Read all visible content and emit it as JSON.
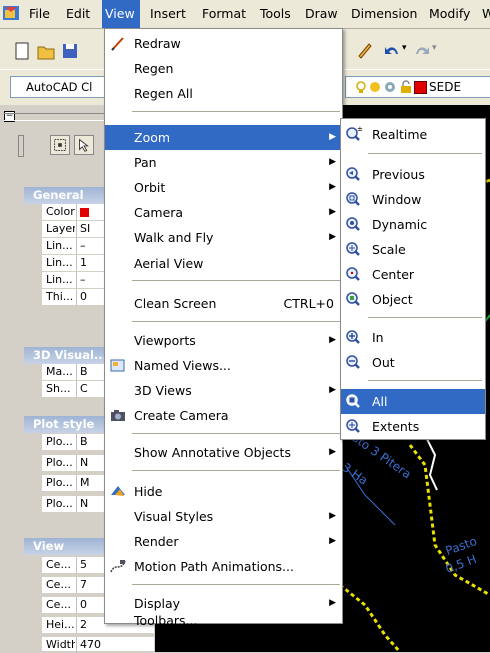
{
  "menubar": {
    "items": [
      "File",
      "Edit",
      "View",
      "Insert",
      "Format",
      "Tools",
      "Draw",
      "Dimension",
      "Modify",
      "W"
    ],
    "active": "View"
  },
  "toolbar": {
    "workspace": "AutoCAD Cl",
    "layer_name": "SEDE"
  },
  "properties": {
    "sections": [
      {
        "title": "General",
        "rows": [
          [
            "Color",
            ""
          ],
          [
            "Layer",
            "SI"
          ],
          [
            "Lin...",
            "–"
          ],
          [
            "Lin...",
            "1"
          ],
          [
            "Lin...",
            "–"
          ],
          [
            "Thi...",
            "0"
          ]
        ]
      },
      {
        "title": "3D Visual...",
        "rows": [
          [
            "Ma...",
            "B"
          ],
          [
            "Sh...",
            "C"
          ]
        ]
      },
      {
        "title": "Plot style",
        "rows": [
          [
            "Plo...",
            "B"
          ],
          [
            "Plo...",
            "N"
          ],
          [
            "Plo...",
            "M"
          ],
          [
            "Plo...",
            "N"
          ]
        ]
      },
      {
        "title": "View",
        "rows": [
          [
            "Ce...",
            "5"
          ],
          [
            "Ce...",
            "7"
          ],
          [
            "Ce...",
            "0"
          ],
          [
            "Hei...",
            "2"
          ],
          [
            "Width",
            "470"
          ]
        ]
      }
    ]
  },
  "view_menu": {
    "items": [
      {
        "label": "Redraw",
        "icon": "redraw-icon"
      },
      {
        "label": "Regen"
      },
      {
        "label": "Regen All"
      },
      {
        "label": "Zoom",
        "submenu": true,
        "highlighted": true
      },
      {
        "label": "Pan",
        "submenu": true
      },
      {
        "label": "Orbit",
        "submenu": true
      },
      {
        "label": "Camera",
        "submenu": true
      },
      {
        "label": "Walk and Fly",
        "submenu": true
      },
      {
        "label": "Aerial View"
      },
      {
        "label": "Clean Screen",
        "shortcut": "CTRL+0"
      },
      {
        "label": "Viewports",
        "submenu": true
      },
      {
        "label": "Named Views...",
        "icon": "named-views-icon"
      },
      {
        "label": "3D Views",
        "submenu": true
      },
      {
        "label": "Create Camera",
        "icon": "camera-icon"
      },
      {
        "label": "Show Annotative Objects",
        "submenu": true
      },
      {
        "label": "Hide",
        "icon": "hide-icon"
      },
      {
        "label": "Visual Styles",
        "submenu": true
      },
      {
        "label": "Render",
        "submenu": true
      },
      {
        "label": "Motion Path Animations...",
        "icon": "motion-path-icon"
      },
      {
        "label": "Display",
        "submenu": true
      },
      {
        "label": "Toolbars..."
      }
    ]
  },
  "zoom_menu": {
    "items": [
      {
        "label": "Realtime"
      },
      {
        "label": "Previous"
      },
      {
        "label": "Window"
      },
      {
        "label": "Dynamic"
      },
      {
        "label": "Scale"
      },
      {
        "label": "Center"
      },
      {
        "label": "Object"
      },
      {
        "label": "In"
      },
      {
        "label": "Out"
      },
      {
        "label": "All",
        "highlighted": true
      },
      {
        "label": "Extents"
      }
    ]
  },
  "drawing_labels": [
    "asto 3 Pitera",
    "3 Ha",
    "Pasto",
    "0,5 H"
  ],
  "colors": {
    "highlight": "#316ac5",
    "drawing_bg": "#000000",
    "yellow_line": "#e8e000",
    "label_blue": "#3b6fd1"
  }
}
